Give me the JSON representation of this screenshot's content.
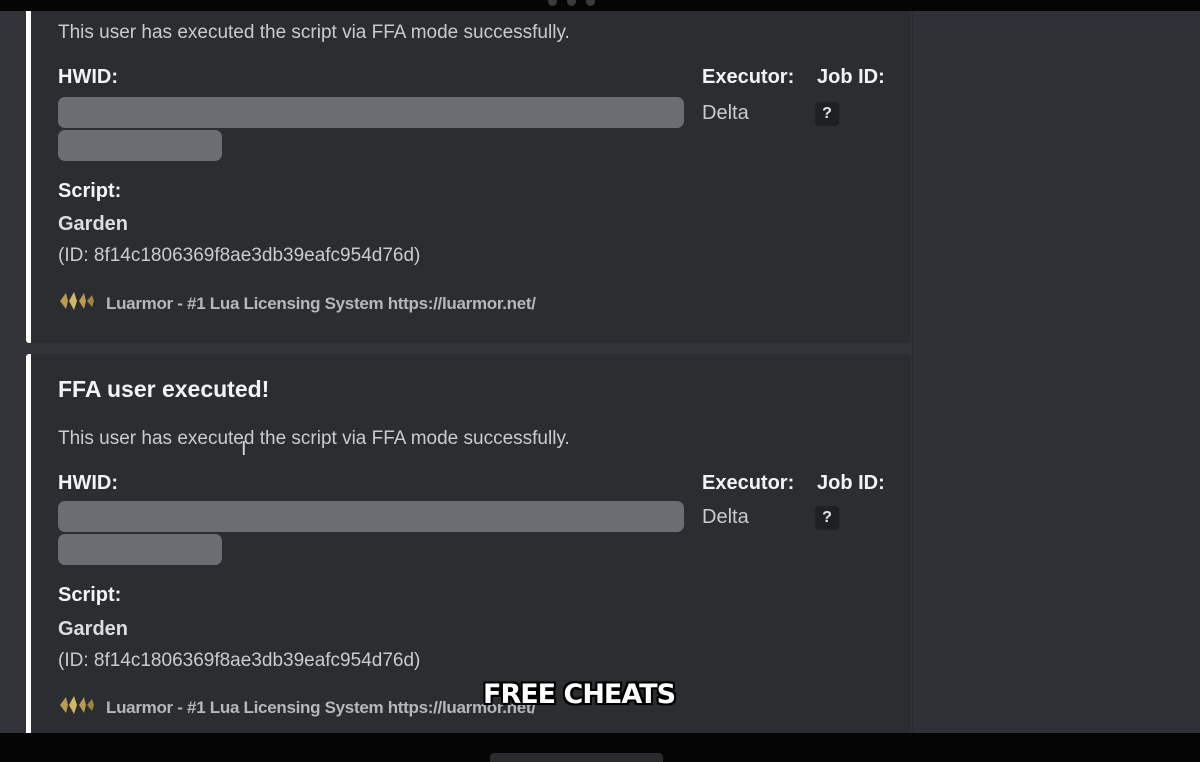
{
  "embeds": [
    {
      "title": "",
      "description": "This user has executed the script via FFA mode successfully.",
      "hwid_label": "HWID:",
      "executor_label": "Executor:",
      "executor_value": "Delta",
      "job_id_label": "Job ID:",
      "job_id_value": "?",
      "script_label": "Script:",
      "script_name": "Garden",
      "script_id": "(ID: 8f14c1806369f8ae3db39eafc954d76d)",
      "footer_text": "Luarmor - #1 Lua Licensing System https://luarmor.net/",
      "footer_icon": "luarmor-logo-icon"
    },
    {
      "title": "FFA user executed!",
      "description": "This user has executed the script via FFA mode successfully.",
      "hwid_label": "HWID:",
      "executor_label": "Executor:",
      "executor_value": "Delta",
      "job_id_label": "Job ID:",
      "job_id_value": "?",
      "script_label": "Script:",
      "script_name": "Garden",
      "script_id": "(ID: 8f14c1806369f8ae3db39eafc954d76d)",
      "footer_text": "Luarmor - #1 Lua Licensing System https://luarmor.net/",
      "footer_icon": "luarmor-logo-icon"
    }
  ],
  "overlay_caption": "FREE CHEATS",
  "colors": {
    "background": "#313338",
    "embed_background": "#2b2d31",
    "embed_accent": "#ffffff",
    "redaction": "#6b6d73"
  }
}
